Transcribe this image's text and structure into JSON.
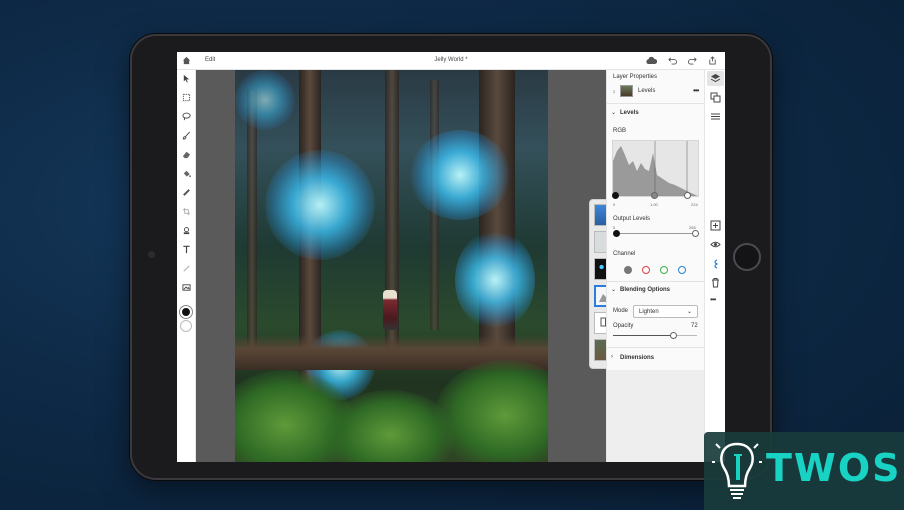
{
  "app": {
    "edit_label": "Edit",
    "document_title": "Jelly World *"
  },
  "layer_properties": {
    "heading": "Layer Properties",
    "layer_number": "2",
    "layer_name": "Levels"
  },
  "levels": {
    "heading": "Levels",
    "channel_label": "RGB",
    "input_values": [
      "0",
      "1.00",
      "224"
    ],
    "output_heading": "Output Levels",
    "output_values": [
      "0",
      "255"
    ],
    "channel_heading": "Channel",
    "channels": [
      {
        "name": "composite",
        "color": "#777777"
      },
      {
        "name": "red",
        "color": "#e04040"
      },
      {
        "name": "green",
        "color": "#3cb043"
      },
      {
        "name": "blue",
        "color": "#2a7fd4"
      }
    ]
  },
  "blending": {
    "heading": "Blending Options",
    "mode_label": "Mode",
    "mode_value": "Lighten",
    "opacity_label": "Opacity",
    "opacity_value": "72",
    "opacity_fraction": 0.72
  },
  "dimensions": {
    "heading": "Dimensions"
  },
  "colors": {
    "foreground": "#111111",
    "background": "#ffffff",
    "accent_blue": "#2a7fd4"
  },
  "watermark": {
    "text": "TWOS"
  }
}
